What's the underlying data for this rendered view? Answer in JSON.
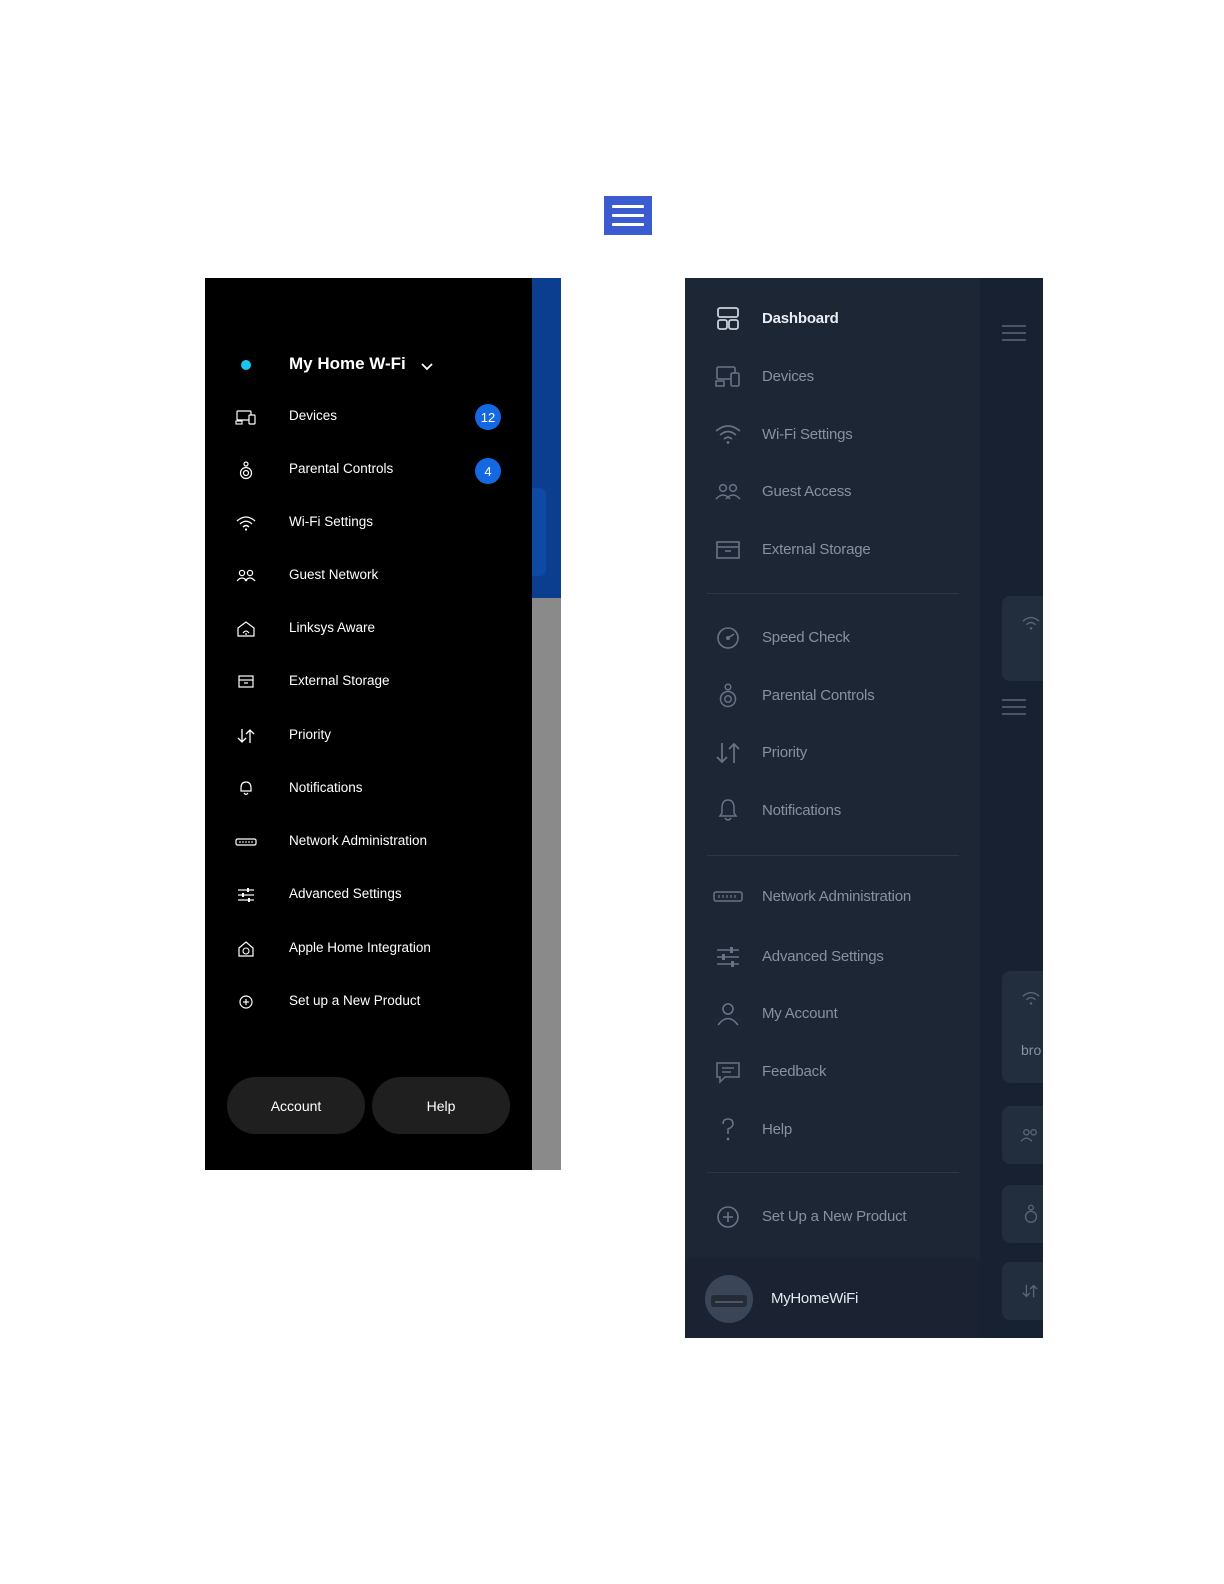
{
  "hamburger_icon": "hamburger-menu-icon",
  "left_menu": {
    "network_name": "My Home W-Fi",
    "items": [
      {
        "label": "Devices",
        "icon": "devices-icon",
        "badge": "12"
      },
      {
        "label": "Parental Controls",
        "icon": "parental-controls-icon",
        "badge": "4"
      },
      {
        "label": "Wi-Fi Settings",
        "icon": "wifi-icon"
      },
      {
        "label": "Guest Network",
        "icon": "guest-network-icon"
      },
      {
        "label": "Linksys Aware",
        "icon": "linksys-aware-icon"
      },
      {
        "label": "External Storage",
        "icon": "external-storage-icon"
      },
      {
        "label": "Priority",
        "icon": "priority-icon"
      },
      {
        "label": "Notifications",
        "icon": "notifications-icon"
      },
      {
        "label": "Network Administration",
        "icon": "network-administration-icon"
      },
      {
        "label": "Advanced Settings",
        "icon": "advanced-settings-icon"
      },
      {
        "label": "Apple Home Integration",
        "icon": "apple-home-icon"
      },
      {
        "label": "Set up a New Product",
        "icon": "add-product-icon"
      }
    ],
    "account_label": "Account",
    "help_label": "Help",
    "accent_color": "#19c6f2",
    "badge_color": "#1469e3"
  },
  "right_menu": {
    "items": [
      {
        "label": "Dashboard",
        "icon": "dashboard-icon",
        "active": true
      },
      {
        "label": "Devices",
        "icon": "devices-icon"
      },
      {
        "label": "Wi-Fi Settings",
        "icon": "wifi-icon"
      },
      {
        "label": "Guest Access",
        "icon": "guest-access-icon"
      },
      {
        "label": "External Storage",
        "icon": "external-storage-icon"
      },
      {
        "label": "Speed Check",
        "icon": "speed-check-icon"
      },
      {
        "label": "Parental Controls",
        "icon": "parental-controls-icon"
      },
      {
        "label": "Priority",
        "icon": "priority-icon"
      },
      {
        "label": "Notifications",
        "icon": "notifications-icon"
      },
      {
        "label": "Network Administration",
        "icon": "network-administration-icon"
      },
      {
        "label": "Advanced Settings",
        "icon": "advanced-settings-icon"
      },
      {
        "label": "My Account",
        "icon": "my-account-icon"
      },
      {
        "label": "Feedback",
        "icon": "feedback-icon"
      },
      {
        "label": "Help",
        "icon": "help-icon"
      },
      {
        "label": "Set Up a New Product",
        "icon": "add-product-icon"
      }
    ],
    "footer_name": "MyHomeWiFi",
    "edge_text": "bro"
  }
}
